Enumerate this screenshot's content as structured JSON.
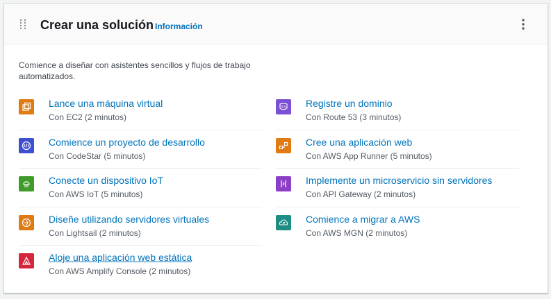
{
  "panel": {
    "title": "Crear una solución",
    "info_link": "Información",
    "description": "Comience a diseñar con asistentes sencillos y flujos de trabajo automatizados."
  },
  "solutions_left": [
    {
      "title": "Lance una máquina virtual",
      "subtitle": "Con EC2 (2 minutos)",
      "icon": "ec2-icon",
      "color": "#e07b14"
    },
    {
      "title": "Comience un proyecto de desarrollo",
      "subtitle": "Con CodeStar (5 minutos)",
      "icon": "codestar-icon",
      "color": "#3f4fd1"
    },
    {
      "title": "Conecte un dispositivo IoT",
      "subtitle": "Con AWS IoT (5 minutos)",
      "icon": "iot-icon",
      "color": "#3f9b2b"
    },
    {
      "title": "Diseñe utilizando servidores virtuales",
      "subtitle": "Con Lightsail (2 minutos)",
      "icon": "lightsail-icon",
      "color": "#e07b14"
    },
    {
      "title": "Aloje una aplicación web estática",
      "subtitle": "Con AWS Amplify Console (2 minutos)",
      "icon": "amplify-icon",
      "color": "#d6263d"
    }
  ],
  "solutions_right": [
    {
      "title": "Registre un dominio",
      "subtitle": "Con Route 53 (3 minutos)",
      "icon": "route53-icon",
      "color": "#7b4fd6"
    },
    {
      "title": "Cree una aplicación web",
      "subtitle": "Con AWS App Runner (5 minutos)",
      "icon": "app-runner-icon",
      "color": "#e07b14"
    },
    {
      "title": "Implemente un microservicio sin servidores",
      "subtitle": "Con API Gateway (2 minutos)",
      "icon": "api-gateway-icon",
      "color": "#8c3fc4"
    },
    {
      "title": "Comience a migrar a AWS",
      "subtitle": "Con AWS MGN (2 minutos)",
      "icon": "mgn-icon",
      "color": "#1e8d84"
    }
  ]
}
